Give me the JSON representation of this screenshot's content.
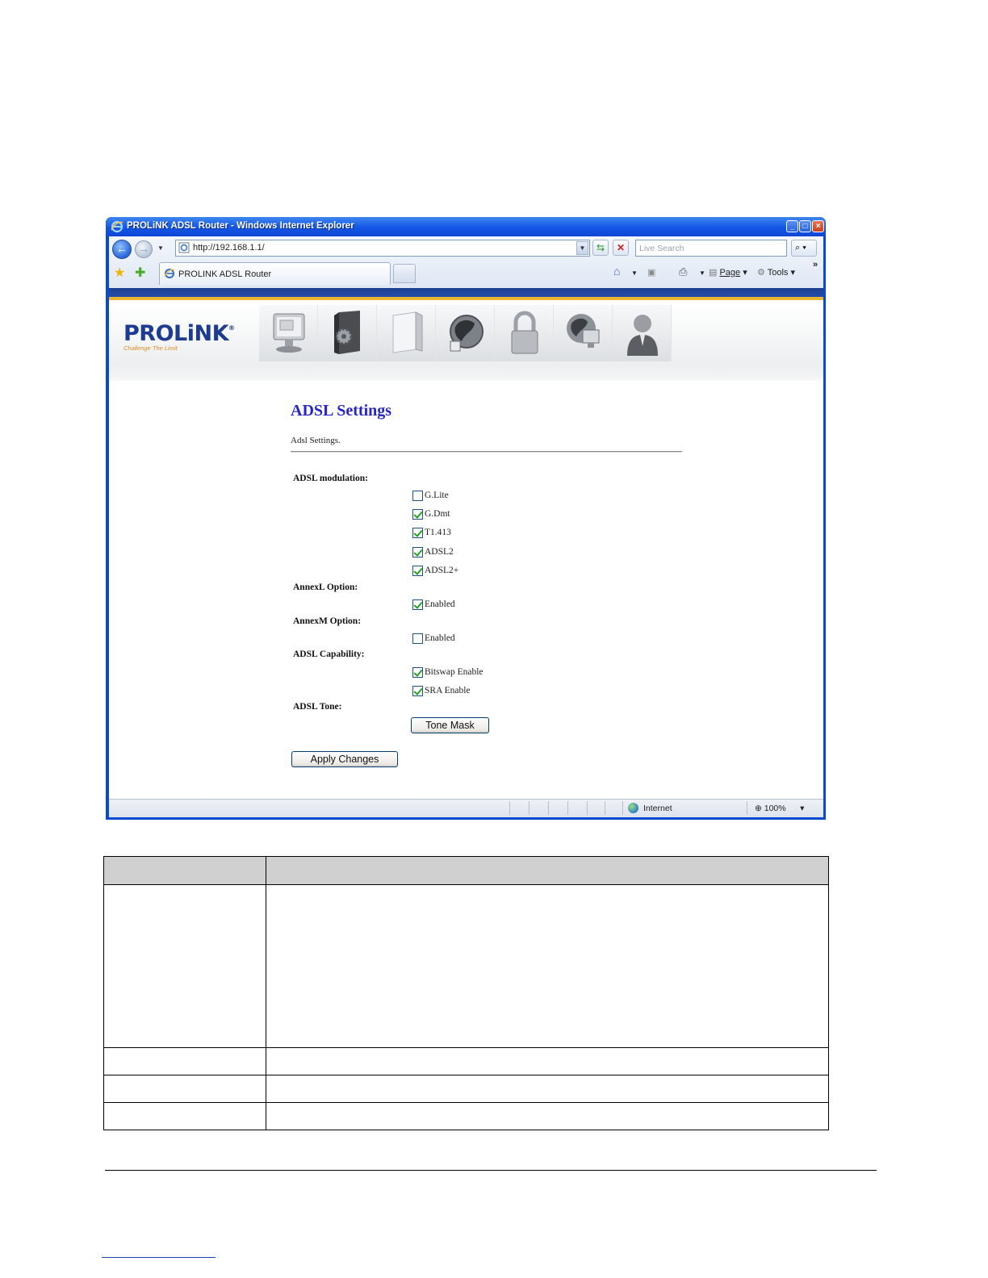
{
  "window": {
    "title": "PROLiNK ADSL Router - Windows Internet Explorer",
    "address": "http://192.168.1.1/",
    "search_placeholder": "Live Search",
    "tab_label": "PROLINK ADSL Router",
    "commands": {
      "page": "Page",
      "tools": "Tools"
    },
    "status": {
      "zone": "Internet",
      "zoom": "100%"
    }
  },
  "router": {
    "brand": "PROLiNK",
    "slogan": "Challenge The Limit",
    "nav_icons": [
      "status-monitor-icon",
      "setup-gear-icon",
      "device-icon",
      "network-globe-icon",
      "security-lock-icon",
      "internet-globe-icon",
      "user-icon"
    ],
    "page_title": "ADSL Settings",
    "page_subtitle": "Adsl Settings.",
    "modulation": {
      "label": "ADSL modulation:",
      "options": [
        {
          "label": "G.Lite",
          "checked": false
        },
        {
          "label": "G.Dmt",
          "checked": true
        },
        {
          "label": "T1.413",
          "checked": true
        },
        {
          "label": "ADSL2",
          "checked": true
        },
        {
          "label": "ADSL2+",
          "checked": true
        }
      ]
    },
    "annexl": {
      "label": "AnnexL Option:",
      "option": "Enabled",
      "checked": true
    },
    "annexm": {
      "label": "AnnexM Option:",
      "option": "Enabled",
      "checked": false
    },
    "capability": {
      "label": "ADSL Capability:",
      "options": [
        {
          "label": "Bitswap Enable",
          "checked": true
        },
        {
          "label": "SRA Enable",
          "checked": true
        }
      ]
    },
    "tone": {
      "label": "ADSL Tone:",
      "button": "Tone Mask"
    },
    "apply_button": "Apply Changes"
  },
  "doc_table": {
    "rows": 4,
    "columns": 2
  }
}
